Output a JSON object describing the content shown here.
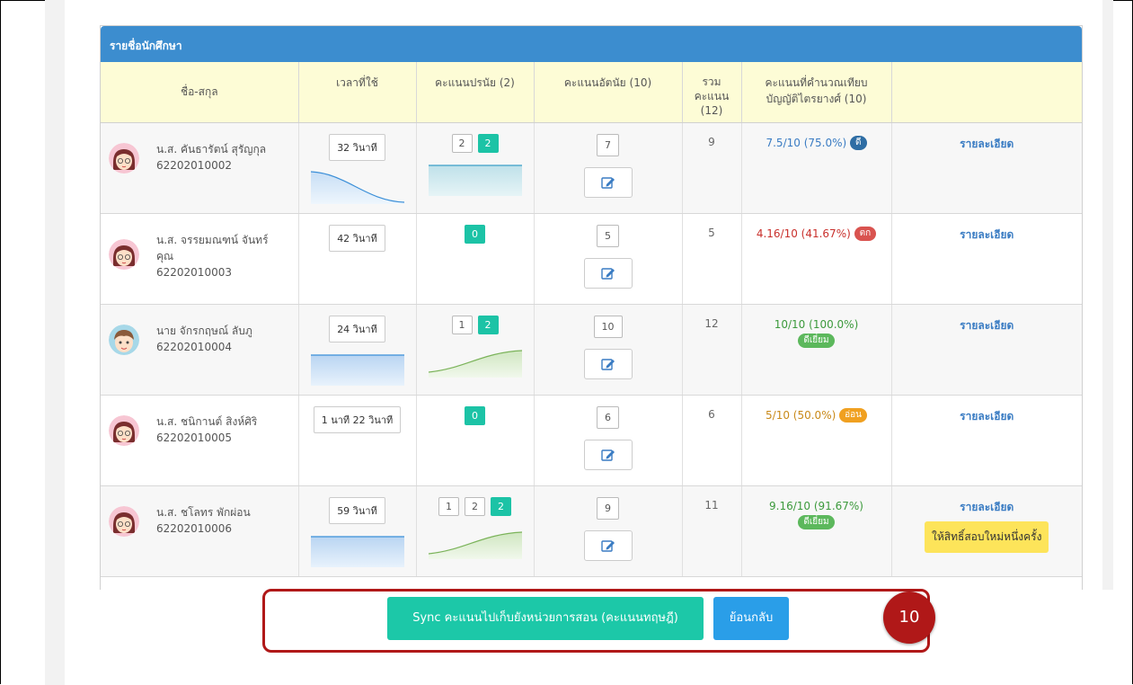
{
  "panel": {
    "title": "รายชื่อนักศึกษา"
  },
  "columns": {
    "name": "ชื่อ-สกุล",
    "time": "เวลาที่ใช้",
    "pretest": "คะแนนปรนัย (2)",
    "posttest": "คะแนนอัตนัย (10)",
    "total_line1": "รวม",
    "total_line2": "คะแนน",
    "total_line3": "(12)",
    "calc_line1": "คะแนนที่คำนวณเทียบ",
    "calc_line2": "บัญญัติไตรยางศ์ (10)",
    "action": ""
  },
  "rows": [
    {
      "name_line1": "น.ส. คันธารัตน์ สุรัญกุล",
      "name_line2": "62202010002",
      "name_line3": "",
      "avatar": "girl-avatar",
      "time": "32 วินาที",
      "pre": [
        "2",
        "2"
      ],
      "post": "7",
      "total": "9",
      "score": "7.5/10 (75.0%)",
      "grade": "ดี",
      "grade_color": "#2e6da4",
      "score_color": "#3a7cc3",
      "detail": "รายละเอียด",
      "retake": ""
    },
    {
      "name_line1": "น.ส. จรรยมณฑน์ จันทร์",
      "name_line2": "คุณ",
      "name_line3": "62202010003",
      "avatar": "girl-avatar",
      "time": "42 วินาที",
      "pre": [
        "0"
      ],
      "post": "5",
      "total": "5",
      "score": "4.16/10 (41.67%)",
      "grade": "ตก",
      "grade_color": "#d9534f",
      "score_color": "#c9302c",
      "detail": "รายละเอียด",
      "retake": ""
    },
    {
      "name_line1": "นาย จักรกฤษณ์ ลับภู",
      "name_line2": "62202010004",
      "name_line3": "",
      "avatar": "boy-avatar",
      "time": "24 วินาที",
      "pre": [
        "1",
        "2"
      ],
      "post": "10",
      "total": "12",
      "score": "10/10 (100.0%)",
      "grade": "ดีเยี่ยม",
      "grade_color": "#5cb85c",
      "score_color": "#3c9a3c",
      "detail": "รายละเอียด",
      "retake": ""
    },
    {
      "name_line1": "น.ส. ชนิกานต์ สิงห์ศิริ",
      "name_line2": "62202010005",
      "name_line3": "",
      "avatar": "girl-avatar",
      "time": "1 นาที 22 วินาที",
      "pre": [
        "0"
      ],
      "post": "6",
      "total": "6",
      "score": "5/10 (50.0%)",
      "grade": "อ่อน",
      "grade_color": "#f0a020",
      "score_color": "#c98a1a",
      "detail": "รายละเอียด",
      "retake": ""
    },
    {
      "name_line1": "น.ส. ชโลทร พักผ่อน",
      "name_line2": "62202010006",
      "name_line3": "",
      "avatar": "girl-avatar",
      "time": "59 วินาที",
      "pre": [
        "1",
        "2",
        "2"
      ],
      "post": "9",
      "total": "11",
      "score": "9.16/10 (91.67%)",
      "grade": "ดีเยี่ยม",
      "grade_color": "#5cb85c",
      "score_color": "#3c9a3c",
      "detail": "รายละเอียด",
      "retake": "ให้สิทธิ์สอบใหม่หนึ่งครั้ง"
    }
  ],
  "footer": {
    "sync_label": "Sync คะแนนไปเก็บยังหน่วยการสอน (คะแนนทฤษฎี)",
    "back_label": "ย้อนกลับ",
    "step_number": "10"
  },
  "colors": {
    "header_blue": "#3c8dcf",
    "teal": "#1cc3a6",
    "annotation_red": "#b01818",
    "retake_yellow": "#fde45a"
  }
}
